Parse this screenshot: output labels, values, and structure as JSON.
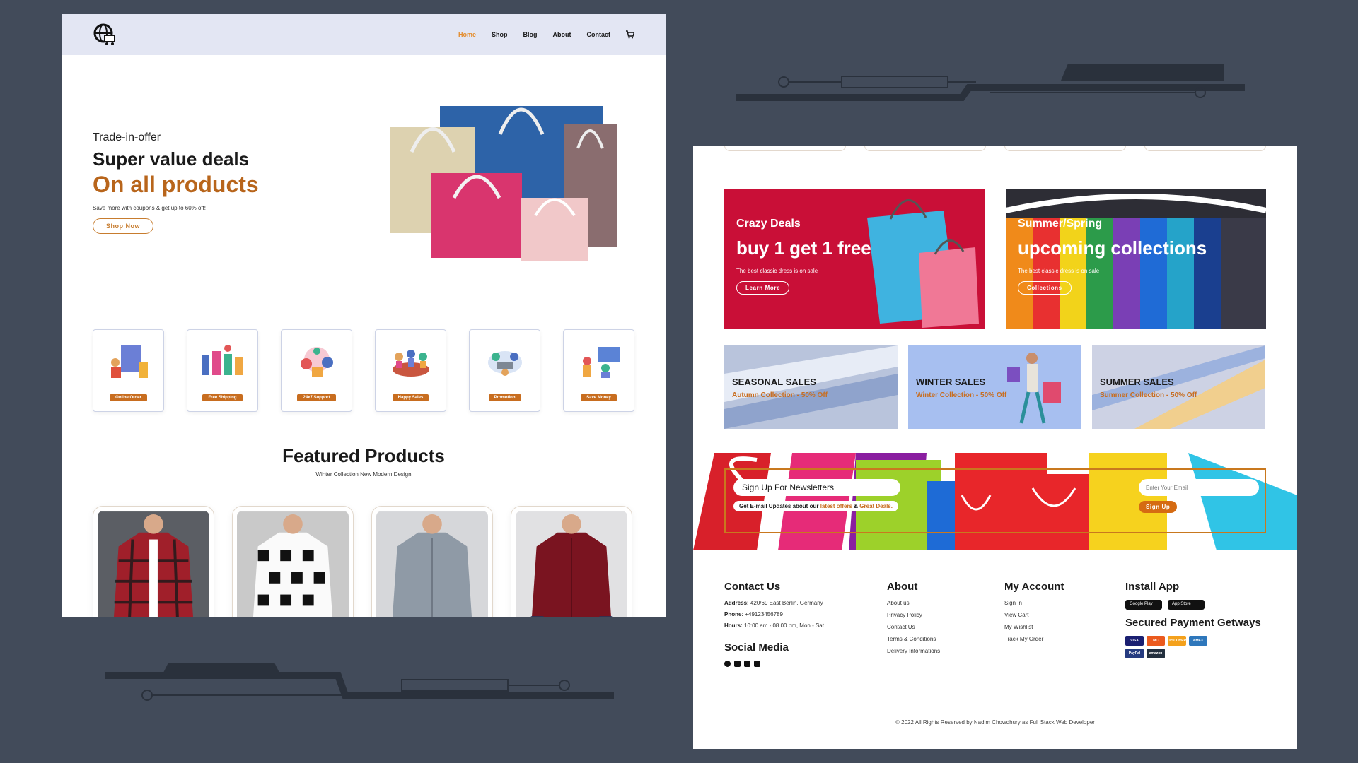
{
  "left": {
    "nav": {
      "links": [
        "Home",
        "Shop",
        "Blog",
        "About",
        "Contact"
      ]
    },
    "hero": {
      "kicker": "Trade-in-offer",
      "title": "Super value deals",
      "title2": "On all products",
      "subtitle": "Save more with coupons & get up to 60% off!",
      "button": "Shop Now"
    },
    "features": [
      "Online Order",
      "Free Shipping",
      "24x7 Support",
      "Happy Sales",
      "Promotion",
      "Save Money"
    ],
    "featured": {
      "title": "Featured Products",
      "subtitle": "Winter Collection New Modern Design"
    }
  },
  "right": {
    "promo1": {
      "kicker": "Crazy Deals",
      "title": "buy 1 get 1 free",
      "subtitle": "The best classic dress is on sale",
      "button": "Learn More"
    },
    "promo2": {
      "kicker": "Summer/Spring",
      "title": "upcoming collections",
      "subtitle": "The best classic dress is on sale",
      "button": "Collections"
    },
    "sales": [
      {
        "title": "SEASONAL SALES",
        "subtitle": "Autumn Collection - 50% Off"
      },
      {
        "title": "WINTER SALES",
        "subtitle": "Winter Collection - 50% Off"
      },
      {
        "title": "SUMMER SALES",
        "subtitle": "Summer Collection - 50% Off"
      }
    ],
    "newsletter": {
      "title": "Sign Up For Newsletters",
      "sub_prefix": "Get E-mail Updates about our ",
      "sub_hl1": "latest offers",
      "sub_mid": " & ",
      "sub_hl2": "Great Deals.",
      "input_placeholder": "Enter Your Email",
      "button": "Sign Up"
    },
    "footer": {
      "contact": {
        "title": "Contact Us",
        "address_label": "Address:",
        "address": "420/69 East Berlin, Germany",
        "phone_label": "Phone:",
        "phone": "+49123456789",
        "hours_label": "Hours:",
        "hours": "10:00 am - 08.00 pm, Mon - Sat"
      },
      "social_title": "Social Media",
      "about": {
        "title": "About",
        "links": [
          "About us",
          "Privacy Policy",
          "Contact Us",
          "Terms & Conditions",
          "Delivery Informations"
        ]
      },
      "account": {
        "title": "My Account",
        "links": [
          "Sign In",
          "View Cart",
          "My Wishlist",
          "Track My Order"
        ]
      },
      "install": {
        "title": "Install App",
        "stores": [
          "Google Play",
          "App Store"
        ],
        "payments_title": "Secured Payment Getways",
        "payments": [
          "VISA",
          "MC",
          "DISCOVER",
          "AMEX",
          "PayPal",
          "amazon"
        ]
      },
      "copyright": "© 2022 All Rights Reserved by Nadim Chowdhury as Full Stack Web Developer"
    }
  },
  "colors": {
    "accent_orange": "#c86d1f",
    "nav_bg": "#e3e6f3",
    "promo_red": "#c90f37",
    "page_bg": "#424b5a"
  }
}
